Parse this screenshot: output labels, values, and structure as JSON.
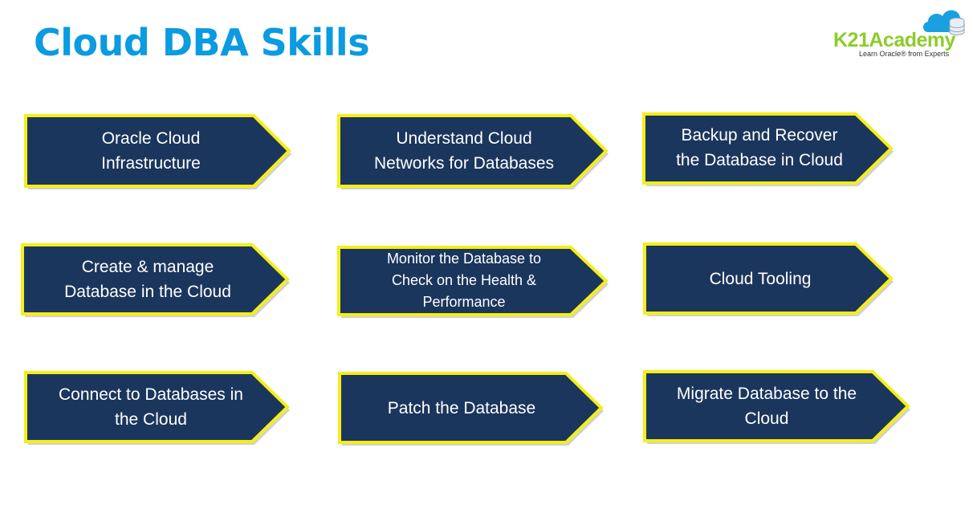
{
  "header": {
    "title": "Cloud DBA Skills"
  },
  "logo": {
    "brand": "K21Academy",
    "tagline": "Learn Oracle® from Experts",
    "icon": "cloud-database-icon",
    "colors": {
      "brand_text": "#8ccc2a",
      "cloud": "#1aa0e0"
    }
  },
  "theme": {
    "title_color": "#0a9be0",
    "arrow_fill": "#1b365d",
    "arrow_border": "#f5ee18",
    "label_color": "#ffffff"
  },
  "skills": [
    {
      "label": "Oracle Cloud\nInfrastructure"
    },
    {
      "label": "Understand Cloud\nNetworks for Databases"
    },
    {
      "label": "Backup and Recover\nthe Database in Cloud"
    },
    {
      "label": "Create & manage\nDatabase in the Cloud"
    },
    {
      "label": "Monitor the Database to\nCheck on the Health &\nPerformance"
    },
    {
      "label": "Cloud Tooling"
    },
    {
      "label": "Connect to Databases in\nthe Cloud"
    },
    {
      "label": "Patch the Database"
    },
    {
      "label": "Migrate Database to the\nCloud"
    }
  ]
}
